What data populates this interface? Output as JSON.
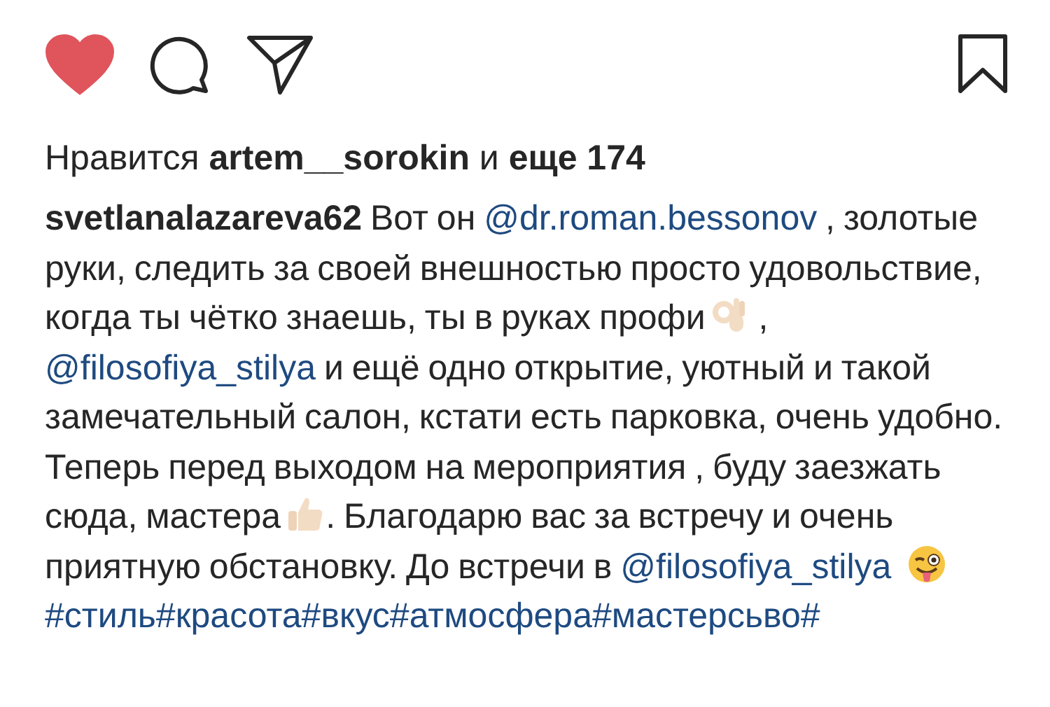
{
  "actions": {
    "liked": true,
    "saved": false
  },
  "likes": "Нравится **artem__sorokin** и **еще 174**",
  "caption": [
    {
      "kind": "username",
      "text": "svetlanalazareva62"
    },
    {
      "kind": "text",
      "text": " Вот он "
    },
    {
      "kind": "mention",
      "text": "@dr.roman.bessonov"
    },
    {
      "kind": "text",
      "text": " , золотые руки, следить за своей внешностью просто удовольствие, когда ты чётко знаешь, ты в руках профи"
    },
    {
      "kind": "ok_hand"
    },
    {
      "kind": "text",
      "text": " , "
    },
    {
      "kind": "mention",
      "text": "@filosofiya_stilya"
    },
    {
      "kind": "text",
      "text": "  и ещё одно открытие, уютный и такой замечательный салон, кстати есть парковка, очень удобно. Теперь перед выходом на мероприятия , буду заезжать сюда, мастера"
    },
    {
      "kind": "thumbs_up"
    },
    {
      "kind": "text",
      "text": ". Благодарю вас за встречу и очень приятную обстановку. До встречи в "
    },
    {
      "kind": "mention",
      "text": "@filosofiya_stilya"
    },
    {
      "kind": "wink"
    },
    {
      "kind": "hashtags",
      "text": "#стиль#красота#вкус#атмосфера#мастерсьво#"
    }
  ]
}
